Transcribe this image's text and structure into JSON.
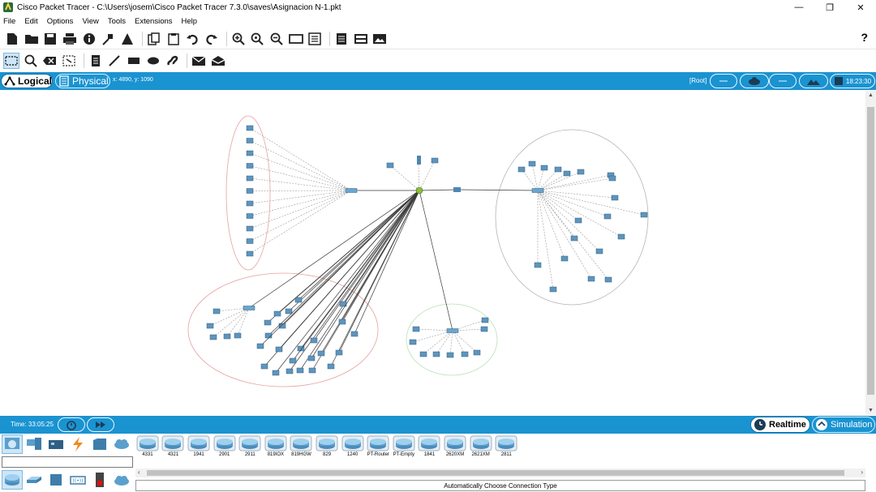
{
  "window": {
    "title": "Cisco Packet Tracer - C:\\Users\\josem\\Cisco Packet Tracer 7.3.0\\saves\\Asignacion N-1.pkt",
    "minimize": "—",
    "maximize": "❐",
    "close": "✕"
  },
  "menu": [
    {
      "label": "File"
    },
    {
      "label": "Edit"
    },
    {
      "label": "Options"
    },
    {
      "label": "View"
    },
    {
      "label": "Tools"
    },
    {
      "label": "Extensions"
    },
    {
      "label": "Help"
    }
  ],
  "toolbar": {
    "help": "?",
    "icons": [
      "new-file-icon",
      "open-folder-icon",
      "save-icon",
      "print-icon",
      "info-icon",
      "wizard-icon",
      "network-info-icon",
      "copy-icon",
      "paste-icon",
      "undo-icon",
      "redo-icon",
      "zoom-in-icon",
      "zoom-reset-icon",
      "zoom-out-icon",
      "drawing-palette-icon",
      "custom-device-icon",
      "text-note-icon",
      "viewport-icon",
      "screenshot-icon"
    ]
  },
  "tools": [
    "select-tool-icon",
    "inspect-tool-icon",
    "delete-tool-icon",
    "resize-tool-icon",
    "note-tool-icon",
    "line-tool-icon",
    "rectangle-tool-icon",
    "ellipse-tool-icon",
    "freeform-tool-icon",
    "simple-pdu-icon",
    "complex-pdu-icon"
  ],
  "workspace_bar": {
    "logical": "Logical",
    "physical": "Physical",
    "coords": "x: 4890, y: 1090",
    "root": "[Root]",
    "clock": "18:23:30"
  },
  "sim_bar": {
    "time": "Time: 33:05:25",
    "realtime": "Realtime",
    "simulation": "Simulation"
  },
  "device_models": [
    "4331",
    "4321",
    "1941",
    "2901",
    "2911",
    "819IOX",
    "819HGW",
    "829",
    "1240",
    "PT-Router",
    "PT-Empty",
    "1841",
    "2620XM",
    "2621XM",
    "2811"
  ],
  "connection_type": "Automatically Choose Connection Type",
  "colors": {
    "accent": "#1a93d1",
    "link": "#3a3a3a",
    "ellipse_red": "#e8a0a0",
    "ellipse_green": "#b8e0b8"
  }
}
